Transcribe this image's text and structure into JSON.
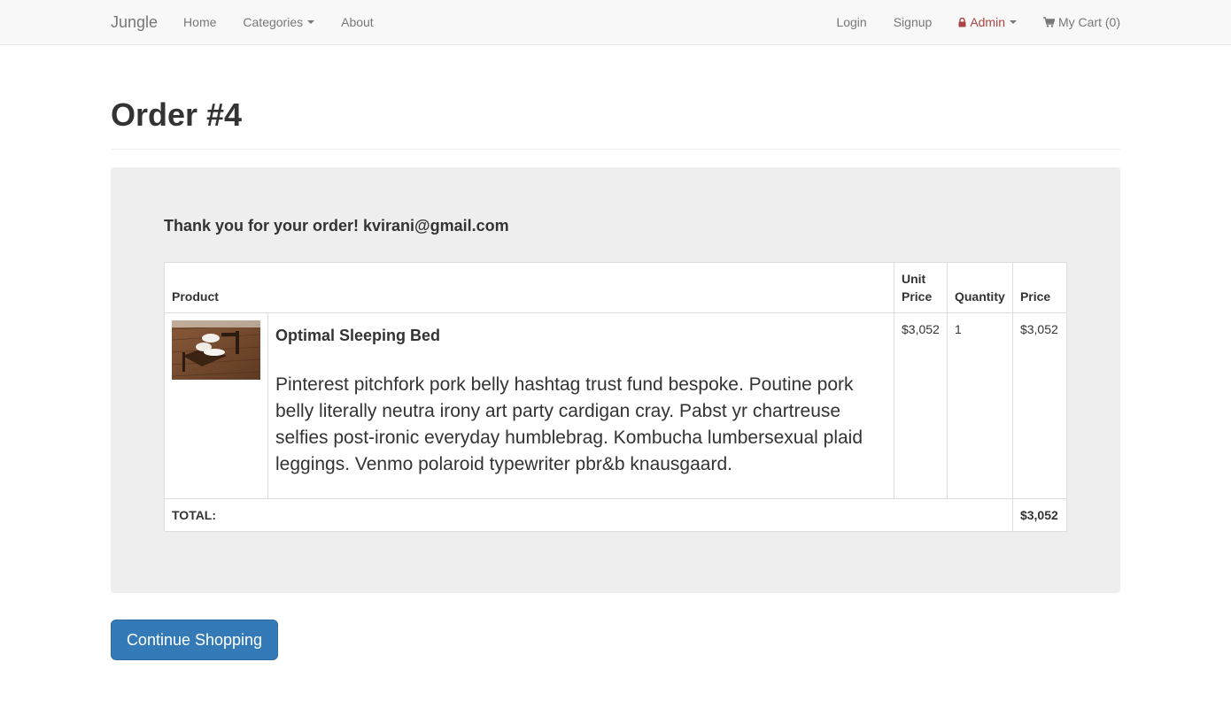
{
  "navbar": {
    "brand": "Jungle",
    "left_links": [
      {
        "label": "Home"
      },
      {
        "label": "Categories"
      },
      {
        "label": "About"
      }
    ],
    "right_links": {
      "login": "Login",
      "signup": "Signup",
      "admin": "Admin",
      "cart": "My Cart (0)"
    }
  },
  "page": {
    "title": "Order #4"
  },
  "order": {
    "thanks_message": "Thank you for your order! kvirani@gmail.com",
    "headers": {
      "product": "Product",
      "unit_price": "Unit Price",
      "quantity": "Quantity",
      "price": "Price"
    },
    "items": [
      {
        "name": "Optimal Sleeping Bed",
        "description": "Pinterest pitchfork pork belly hashtag trust fund bespoke. Poutine pork belly literally neutra irony art party cardigan cray. Pabst yr chartreuse selfies post-ironic everyday humblebrag. Kombucha lumbersexual plaid leggings. Venmo polaroid typewriter pbr&b knausgaard.",
        "unit_price": "$3,052",
        "quantity": "1",
        "price": "$3,052"
      }
    ],
    "total_label": "TOTAL:",
    "total_value": "$3,052"
  },
  "actions": {
    "continue_label": "Continue Shopping"
  },
  "colors": {
    "primary": "#337ab7",
    "admin": "#a94442",
    "well": "#eeeeee"
  }
}
